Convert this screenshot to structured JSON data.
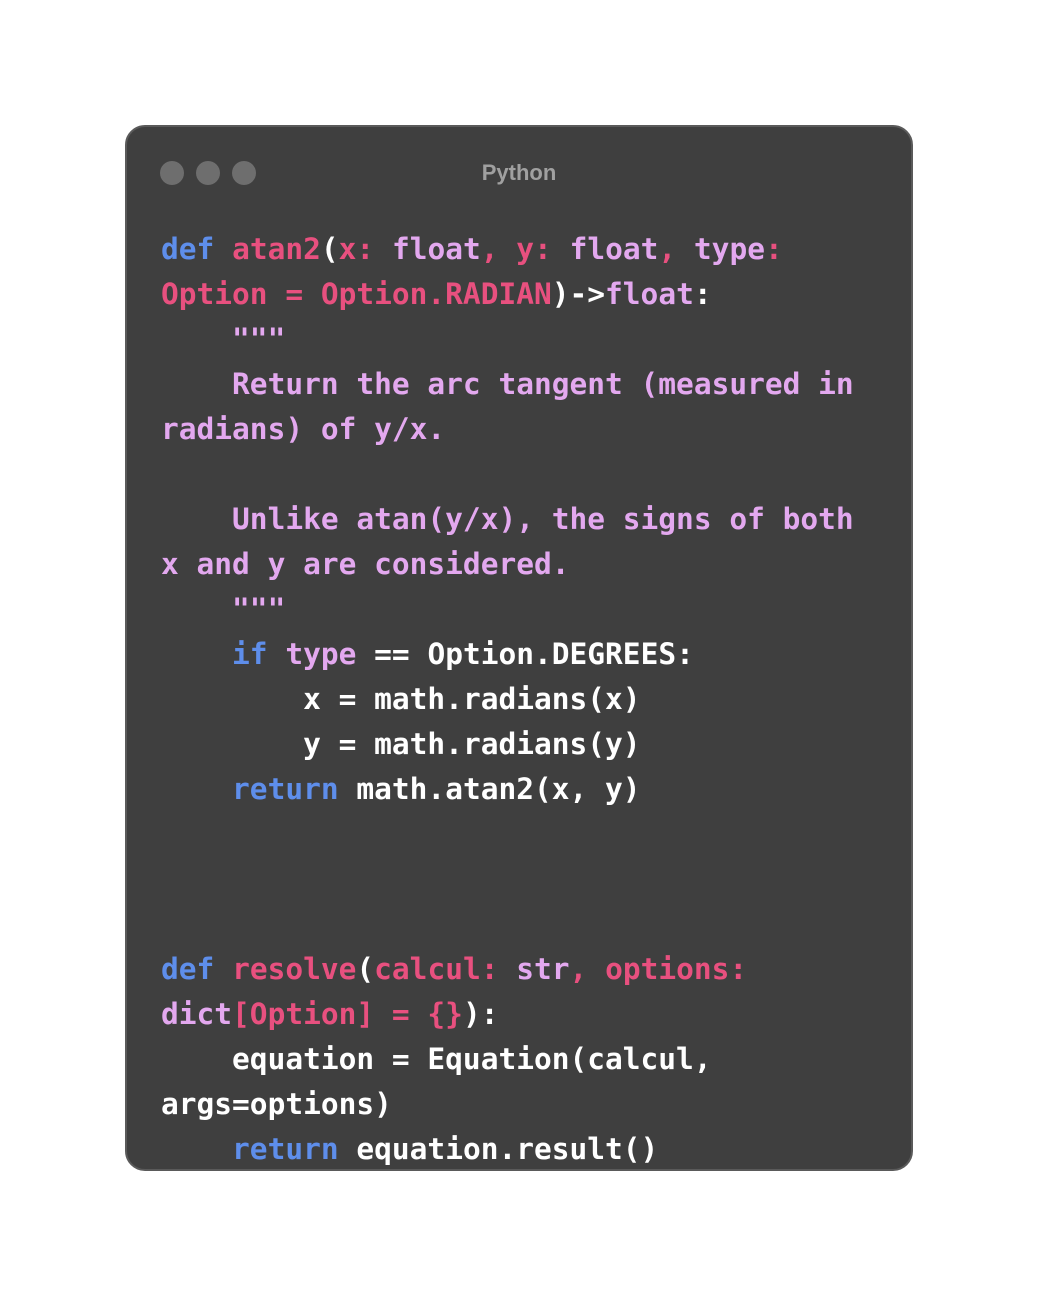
{
  "window": {
    "title": "Python",
    "colors": {
      "background": "#3f3f3f",
      "keyword": "#5e8eeb",
      "function": "#e8507f",
      "type": "#e3a8ef",
      "docstring": "#e3a8ef",
      "plain": "#ffffff",
      "traffic_dot": "#6e6e6e"
    }
  },
  "code": {
    "language": "Python",
    "line1": {
      "kw": "def",
      "fn": "atan2(",
      "p1": "(",
      "x": "x:",
      "float1": "float",
      "comma1": ",",
      "y": "y:",
      "float2": "float",
      "comma2": ",",
      "type": "type",
      "colon": ":"
    },
    "line2": {
      "option": "Option = Option.RADIAN",
      "arrow": ")->",
      "float": "float",
      "colon": ":"
    },
    "doc_open": "\"\"\"",
    "doc_line1a": "Return the arc tangent (measured in",
    "doc_line1b": "radians) of y/x.",
    "doc_line2a": "Unlike atan(y/x), the signs of both",
    "doc_line2b": "x and y are considered.",
    "doc_close": "\"\"\"",
    "if_kw": "if",
    "if_type": "type",
    "if_rest": "== Option.DEGREES:",
    "assign_x": "x = math.radians(x)",
    "assign_y": "y = math.radians(y)",
    "return1_kw": "return",
    "return1_rest": "math.atan2(x, y)",
    "resolve_line1": {
      "kw": "def",
      "fn": "resolve",
      "paren": "(",
      "calcul": "calcul:",
      "str": "str",
      "comma": ",",
      "options": "options:"
    },
    "resolve_line2": {
      "dict": "dict",
      "generic": "[Option] = {}",
      "close": "):"
    },
    "equation_line1": "equation = Equation(calcul,",
    "equation_line2": "args=options)",
    "return2_kw": "return",
    "return2_rest": "equation.result()"
  }
}
